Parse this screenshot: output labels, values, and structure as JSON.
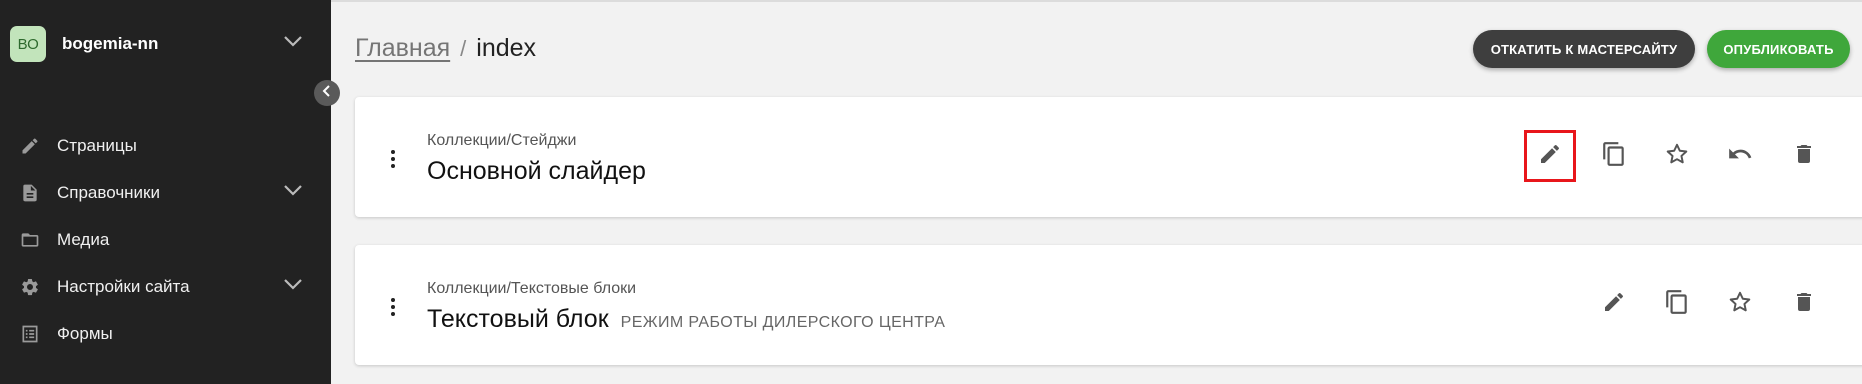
{
  "sidebar": {
    "site_initials": "BO",
    "site_name": "bogemia-nn",
    "items": [
      {
        "label": "Страницы",
        "icon": "pencil-icon"
      },
      {
        "label": "Справочники",
        "icon": "document-icon"
      },
      {
        "label": "Медиа",
        "icon": "folder-icon"
      },
      {
        "label": "Настройки сайта",
        "icon": "gear-icon"
      },
      {
        "label": "Формы",
        "icon": "form-icon"
      }
    ]
  },
  "header": {
    "breadcrumb_home": "Главная",
    "breadcrumb_sep": "/",
    "breadcrumb_current": "index",
    "revert_label": "ОТКАТИТЬ К МАСТЕРСАЙТУ",
    "publish_label": "ОПУБЛИКОВАТЬ"
  },
  "blocks": [
    {
      "path": "Коллекции/Стейджи",
      "title": "Основной слайдер",
      "subtitle": ""
    },
    {
      "path": "Коллекции/Текстовые блоки",
      "title": "Текстовый блок",
      "subtitle": "РЕЖИМ РАБОТЫ ДИЛЕРСКОГО ЦЕНТРА"
    }
  ],
  "colors": {
    "sidebar_bg": "#222222",
    "accent_green": "#3fa73b",
    "highlight_red": "#e8161b"
  }
}
